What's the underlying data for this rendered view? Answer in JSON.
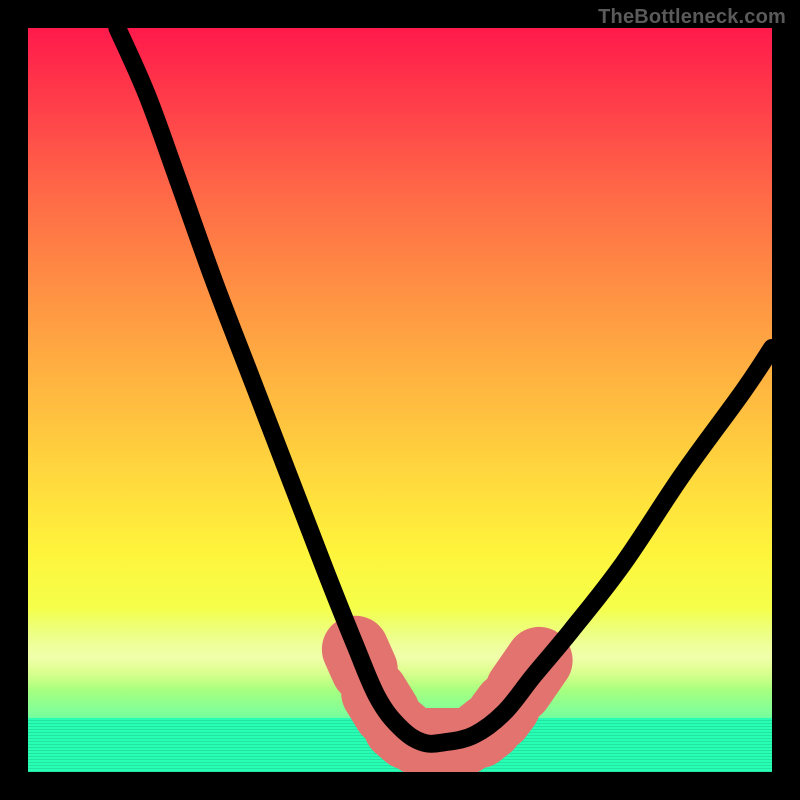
{
  "attribution": "TheBottleneck.com",
  "colors": {
    "gradient_top": "#ff1a4b",
    "gradient_bottom": "#1effbf",
    "dash": "#e2736e",
    "line": "#000000",
    "frame": "#000000"
  },
  "chart_data": {
    "type": "line",
    "title": "",
    "xlabel": "",
    "ylabel": "",
    "xlim": [
      0,
      100
    ],
    "ylim": [
      0,
      100
    ],
    "note": "Bottleneck-style curve. Window-relative coords (0–100, origin top-left). Lower y = higher position on gradient (worse).",
    "series": [
      {
        "name": "bottleneck-curve",
        "x": [
          12,
          16,
          20,
          25,
          30,
          35,
          40,
          44,
          47,
          50,
          53,
          56,
          60,
          64,
          68,
          73,
          80,
          88,
          96,
          100
        ],
        "y": [
          0,
          9,
          20,
          34,
          47,
          60,
          73,
          83,
          90,
          94,
          96,
          96,
          95,
          92,
          87,
          81,
          72,
          60,
          49,
          43
        ]
      }
    ],
    "dashes": [
      {
        "x1": 44.0,
        "y1": 83.5,
        "x2": 45.2,
        "y2": 86.2
      },
      {
        "x1": 46.6,
        "y1": 89.4,
        "x2": 48.2,
        "y2": 92.0
      },
      {
        "x1": 49.6,
        "y1": 94.0,
        "x2": 51.0,
        "y2": 95.2
      },
      {
        "x1": 52.4,
        "y1": 95.9,
        "x2": 58.6,
        "y2": 95.9
      },
      {
        "x1": 60.6,
        "y1": 95.0,
        "x2": 62.0,
        "y2": 93.9
      },
      {
        "x1": 63.3,
        "y1": 92.6,
        "x2": 64.4,
        "y2": 91.1
      },
      {
        "x1": 66.0,
        "y1": 88.9,
        "x2": 68.7,
        "y2": 85.0
      }
    ]
  }
}
